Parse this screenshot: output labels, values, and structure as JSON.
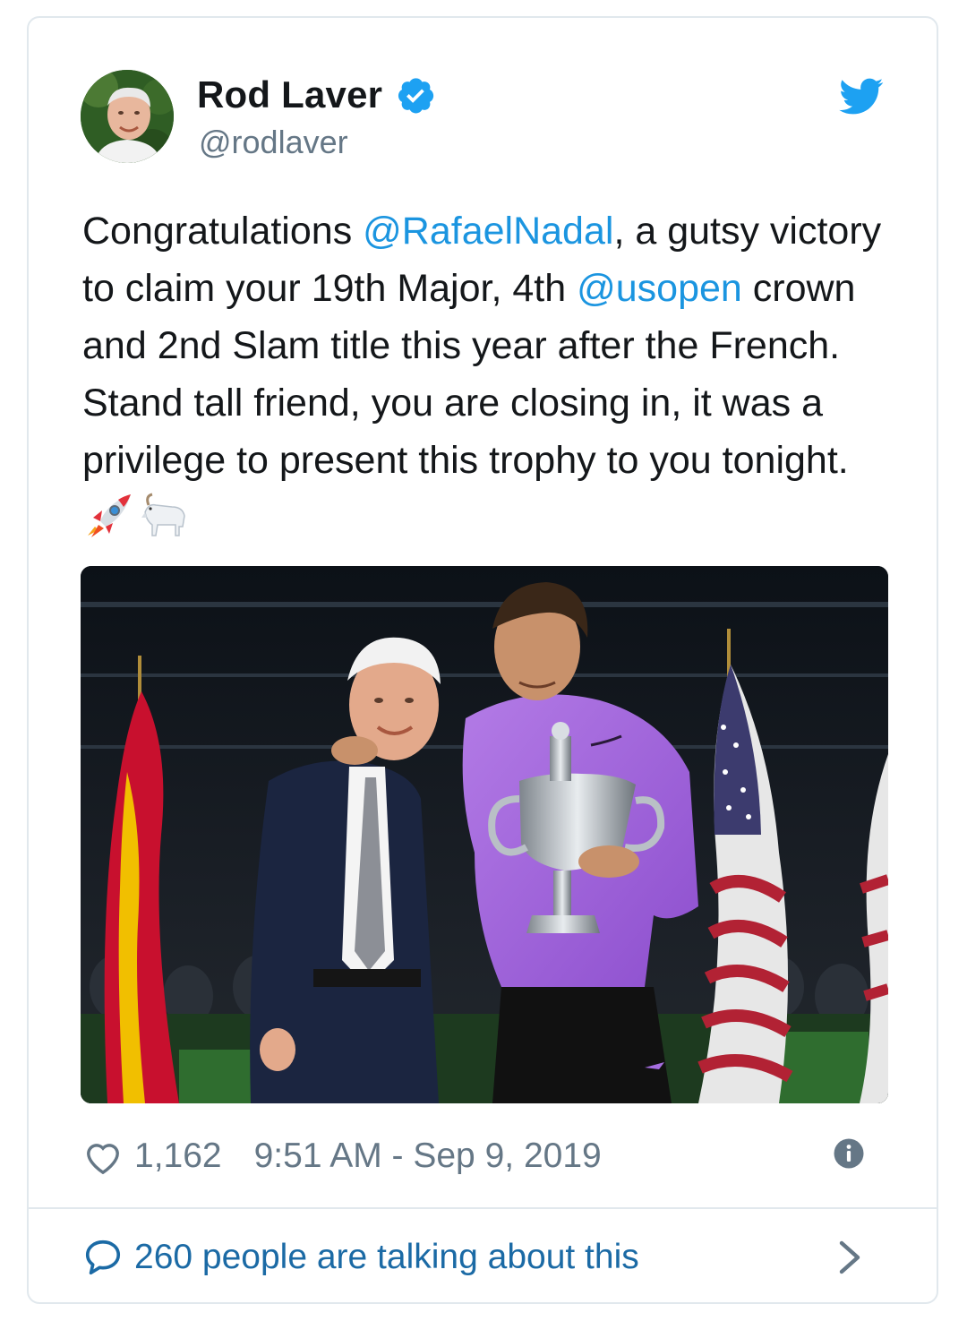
{
  "author": {
    "display_name": "Rod Laver",
    "handle": "@rodlaver",
    "verified": true
  },
  "tweet": {
    "text_1": "Congratulations ",
    "mention_1": "@RafaelNadal",
    "text_2": ", a gutsy victory to claim your 19th Major, 4th ",
    "mention_2": "@usopen",
    "text_3": " crown and 2nd Slam title this year after the French. Stand tall friend, you are closing in, it was a privilege to present this trophy to you tonight.",
    "emojis": [
      "rocket-icon",
      "goat-icon"
    ]
  },
  "meta": {
    "likes": "1,162",
    "timestamp": "9:51 AM - Sep 9, 2019"
  },
  "footer": {
    "talking_label": "260 people are talking about this"
  },
  "colors": {
    "link": "#1b95e0",
    "text": "#14171a",
    "muted": "#657786",
    "border": "#e1e8ed",
    "twitter_blue": "#1da1f2"
  }
}
